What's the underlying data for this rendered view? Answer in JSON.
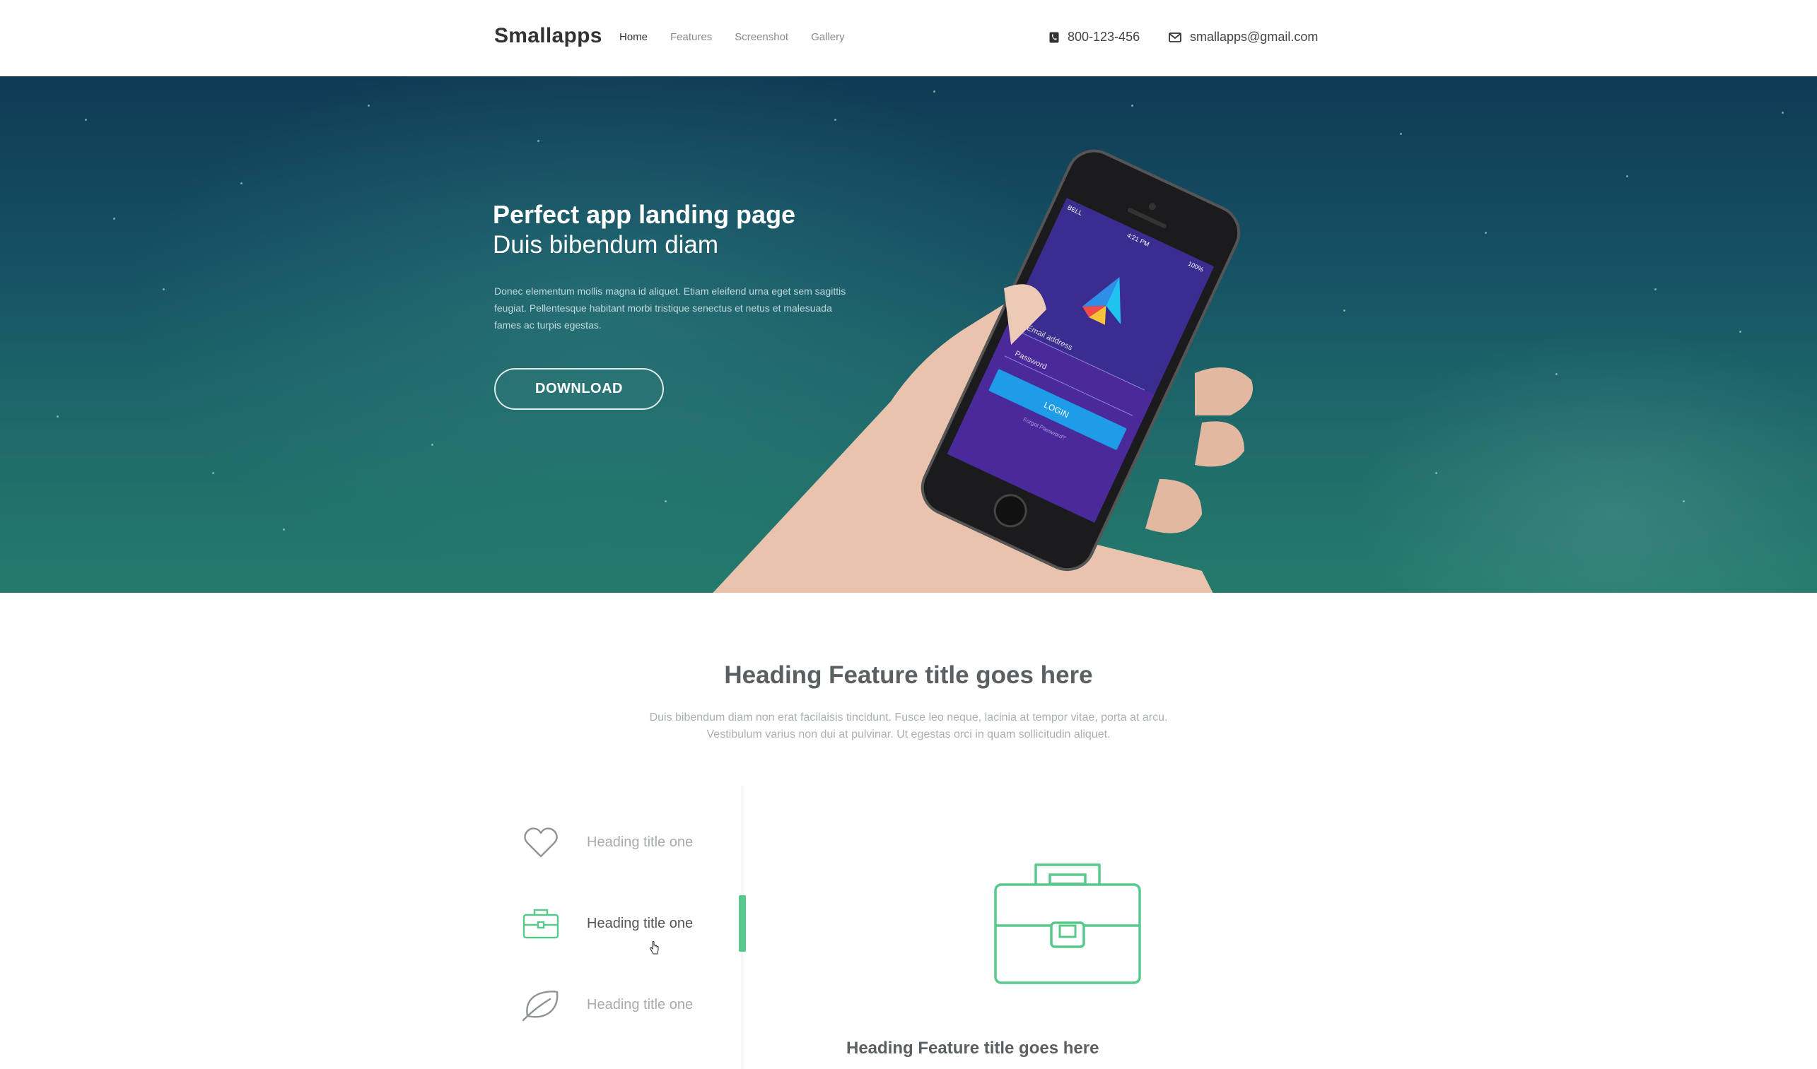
{
  "header": {
    "brand": "Smallapps",
    "nav": [
      "Home",
      "Features",
      "Screenshot",
      "Gallery"
    ],
    "active_nav": "Home",
    "phone": "800-123-456",
    "email": "smallapps@gmail.com"
  },
  "hero": {
    "title": "Perfect app landing page",
    "subtitle": "Duis bibendum diam",
    "description": "Donec elementum mollis magna id aliquet. Etiam eleifend urna eget sem sagittis feugiat. Pellentesque habitant morbi tristique senectus et netus et malesuada fames ac turpis egestas.",
    "download_label": "DOWNLOAD",
    "phone_screen": {
      "carrier": "BELL",
      "time": "4:21 PM",
      "battery": "100%",
      "email_placeholder": "Email address",
      "password_placeholder": "Password",
      "login_label": "LOGIN",
      "forgot_label": "Forgot Password?"
    }
  },
  "features": {
    "heading": "Heading Feature title goes here",
    "description_line1": "Duis bibendum diam non erat facilaisis tincidunt. Fusce leo neque, lacinia at tempor vitae, porta at arcu.",
    "description_line2": "Vestibulum varius non dui at pulvinar. Ut egestas orci in quam sollicitudin aliquet.",
    "items": [
      {
        "label": "Heading title one",
        "icon": "heart-icon"
      },
      {
        "label": "Heading title one",
        "icon": "briefcase-icon"
      },
      {
        "label": "Heading title one",
        "icon": "leaf-icon"
      }
    ],
    "active_index": 1,
    "detail_title": "Heading Feature title goes here",
    "accent_color": "#58c98a"
  }
}
